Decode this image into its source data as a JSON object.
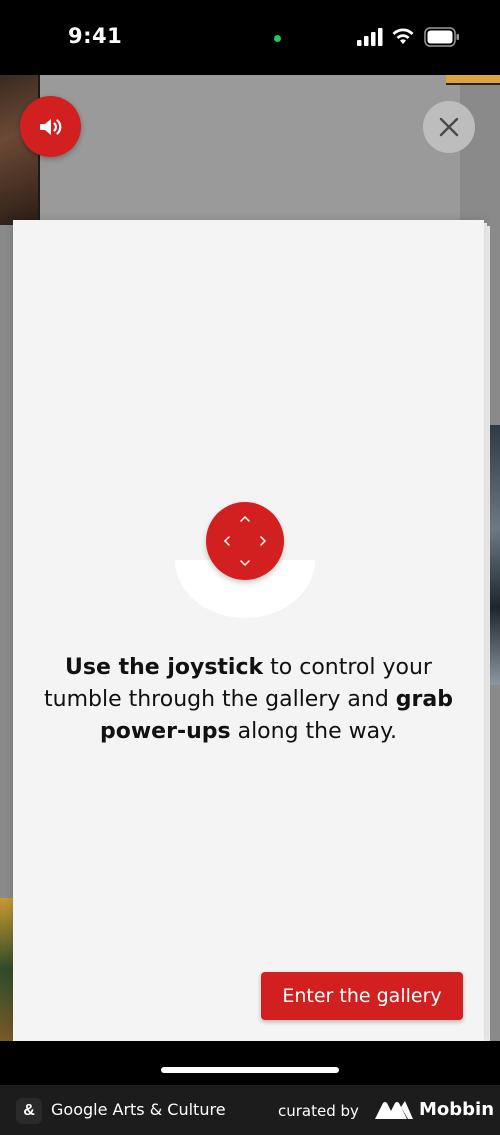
{
  "status_bar": {
    "time": "9:41",
    "icons": [
      "signal-icon",
      "wifi-icon",
      "battery-icon"
    ]
  },
  "controls": {
    "sound_icon": "speaker-icon",
    "close_icon": "close-icon"
  },
  "card": {
    "instruction": {
      "bold_1": "Use the joystick",
      "text_1": " to control your tumble through the gallery and ",
      "bold_2": "grab power-ups",
      "text_2": " along the way."
    },
    "enter_button": "Enter the gallery"
  },
  "footer": {
    "app_logo_glyph": "&",
    "app_name": "Google Arts & Culture",
    "curated_by": "curated by",
    "brand": "Mobbin"
  },
  "colors": {
    "accent": "#d21f1f",
    "card": "#f4f4f4",
    "footer": "#1c1c1c"
  }
}
